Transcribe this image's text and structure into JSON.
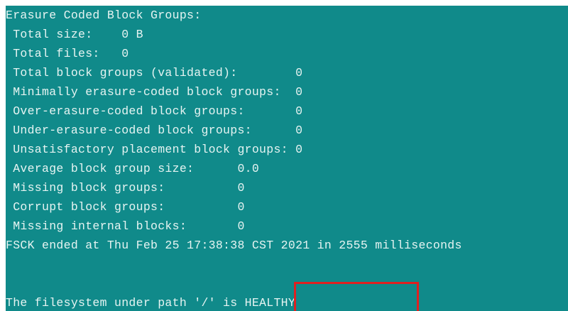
{
  "terminal": {
    "lines": [
      "Erasure Coded Block Groups:",
      " Total size:    0 B",
      " Total files:   0",
      " Total block groups (validated):        0",
      " Minimally erasure-coded block groups:  0",
      " Over-erasure-coded block groups:       0",
      " Under-erasure-coded block groups:      0",
      " Unsatisfactory placement block groups: 0",
      " Average block group size:      0.0",
      " Missing block groups:          0",
      " Corrupt block groups:          0",
      " Missing internal blocks:       0",
      "FSCK ended at Thu Feb 25 17:38:38 CST 2021 in 2555 milliseconds",
      "",
      "The filesystem under path '/' is HEALTHY"
    ]
  },
  "colors": {
    "terminal_background": "#108a8a",
    "terminal_text": "#e6f4f2",
    "highlight_border": "#e02020"
  }
}
